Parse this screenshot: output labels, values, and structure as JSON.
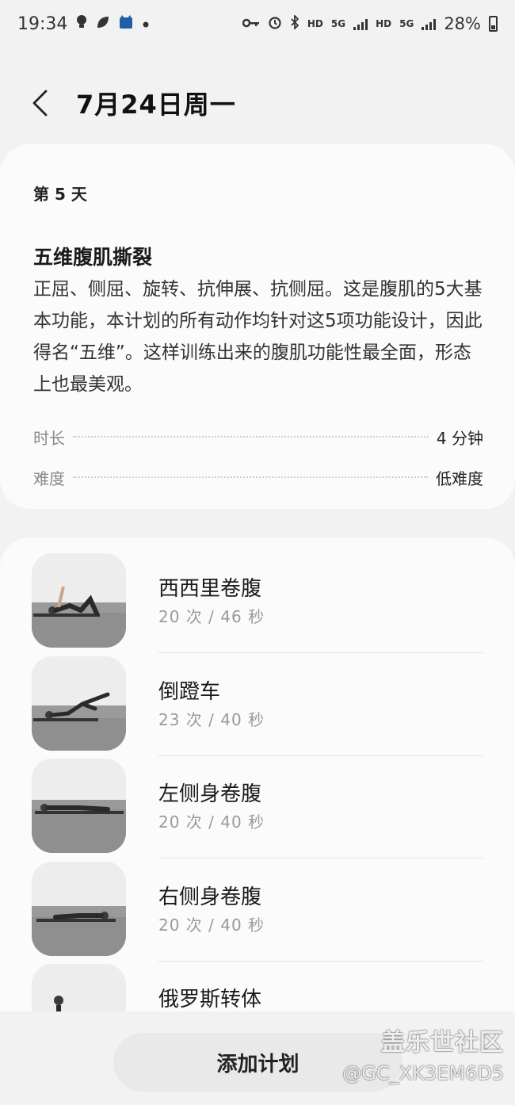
{
  "status_bar": {
    "time": "19:34",
    "battery": "28%",
    "hd1": "HD",
    "g1": "5G",
    "hd2": "HD",
    "g2": "5G"
  },
  "header": {
    "title": "7月24日周一"
  },
  "plan": {
    "day": "第 5 天",
    "title": "五维腹肌撕裂",
    "description": "正屈、侧屈、旋转、抗伸展、抗侧屈。这是腹肌的5大基本功能，本计划的所有动作均针对这5项功能设计，因此得名“五维”。这样训练出来的腹肌功能性最全面，形态上也最美观。",
    "duration_label": "时长",
    "duration_value": "4 分钟",
    "difficulty_label": "难度",
    "difficulty_value": "低难度"
  },
  "exercises": [
    {
      "name": "西西里卷腹",
      "meta": "20 次 / 46 秒"
    },
    {
      "name": "倒蹬车",
      "meta": "23 次 / 40 秒"
    },
    {
      "name": "左侧身卷腹",
      "meta": "20 次 / 40 秒"
    },
    {
      "name": "右侧身卷腹",
      "meta": "20 次 / 40 秒"
    },
    {
      "name": "俄罗斯转体",
      "meta": ""
    }
  ],
  "add_button_label": "添加计划",
  "watermark": {
    "line1": "盖乐世社区",
    "line2": "@GC_XK3EM6D5"
  }
}
